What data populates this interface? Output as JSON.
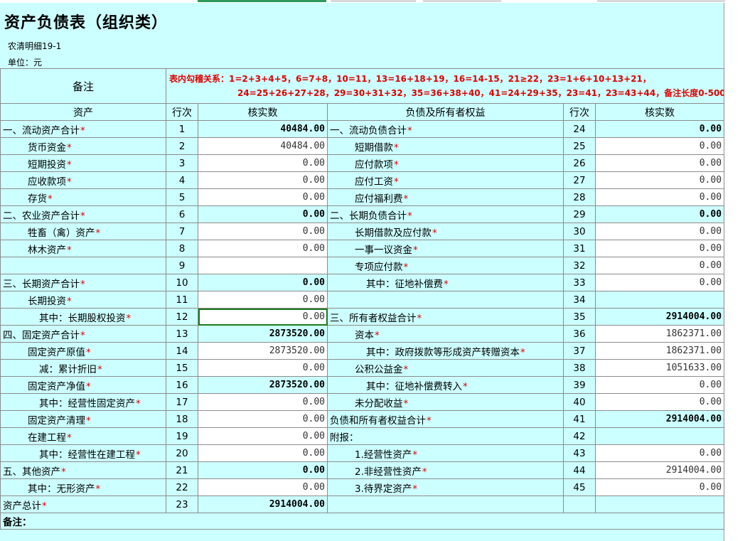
{
  "title": "资产负债表（组织类）",
  "form_code": "农清明细19-1",
  "unit_text": "单位：元",
  "note": {
    "label": "备注",
    "line1": "表内勾稽关系：1=2+3+4+5，6=7+8，10=11，13=16+18+19，16=14-15，21≥22，23=1+6+10+13+21，",
    "line2": "24=25+26+27+28，29=30+31+32，35=36+38+40，41=24+29+35，23=41，23=43+44，备注长度0-500。"
  },
  "columns": {
    "assets": "资产",
    "line_no": "行次",
    "verified": "核实数",
    "liabilities": "负债及所有者权益"
  },
  "star": "*",
  "rows": [
    {
      "left": {
        "label": "一、流动资产合计",
        "star": true,
        "indent": 0,
        "no": "1",
        "value": "40484.00",
        "bold": true
      },
      "right": {
        "label": "一、流动负债合计",
        "star": true,
        "indent": 0,
        "no": "24",
        "value": "0.00",
        "bold": true
      }
    },
    {
      "left": {
        "label": "货币资金",
        "star": true,
        "indent": 1,
        "no": "2",
        "value": "40484.00"
      },
      "right": {
        "label": "短期借款",
        "star": true,
        "indent": 1,
        "no": "25",
        "value": "0.00"
      }
    },
    {
      "left": {
        "label": "短期投资",
        "star": true,
        "indent": 1,
        "no": "3",
        "value": "0.00"
      },
      "right": {
        "label": "应付款项",
        "star": true,
        "indent": 1,
        "no": "26",
        "value": "0.00"
      }
    },
    {
      "left": {
        "label": "应收款项",
        "star": true,
        "indent": 1,
        "no": "4",
        "value": "0.00"
      },
      "right": {
        "label": "应付工资",
        "star": true,
        "indent": 1,
        "no": "27",
        "value": "0.00"
      }
    },
    {
      "left": {
        "label": "存货",
        "star": true,
        "indent": 1,
        "no": "5",
        "value": "0.00"
      },
      "right": {
        "label": "应付福利费",
        "star": true,
        "indent": 1,
        "no": "28",
        "value": "0.00"
      }
    },
    {
      "left": {
        "label": "二、农业资产合计",
        "star": true,
        "indent": 0,
        "no": "6",
        "value": "0.00",
        "bold": true
      },
      "right": {
        "label": "二、长期负债合计",
        "star": true,
        "indent": 0,
        "no": "29",
        "value": "0.00",
        "bold": true
      }
    },
    {
      "left": {
        "label": "牲畜（禽）资产",
        "star": true,
        "indent": 1,
        "no": "7",
        "value": "0.00"
      },
      "right": {
        "label": "长期借款及应付款",
        "star": true,
        "indent": 1,
        "no": "30",
        "value": "0.00"
      }
    },
    {
      "left": {
        "label": "林木资产",
        "star": true,
        "indent": 1,
        "no": "8",
        "value": "0.00"
      },
      "right": {
        "label": "一事一议资金",
        "star": true,
        "indent": 1,
        "no": "31",
        "value": "0.00"
      }
    },
    {
      "left": {
        "label": "",
        "star": false,
        "indent": 0,
        "no": "9",
        "value": ""
      },
      "right": {
        "label": "专项应付款",
        "star": true,
        "indent": 1,
        "no": "32",
        "value": "0.00"
      }
    },
    {
      "left": {
        "label": "三、长期资产合计",
        "star": true,
        "indent": 0,
        "no": "10",
        "value": "0.00",
        "bold": true
      },
      "right": {
        "label": "其中：征地补偿费",
        "star": true,
        "indent": 2,
        "no": "33",
        "value": "0.00"
      }
    },
    {
      "left": {
        "label": "长期投资",
        "star": true,
        "indent": 1,
        "no": "11",
        "value": "0.00"
      },
      "right": {
        "label": "",
        "star": false,
        "indent": 0,
        "no": "34",
        "value": "",
        "plain": true
      }
    },
    {
      "left": {
        "label": "其中：长期股权投资",
        "star": true,
        "indent": 2,
        "no": "12",
        "value": "0.00",
        "selected": true
      },
      "right": {
        "label": "三、所有者权益合计",
        "star": true,
        "indent": 0,
        "no": "35",
        "value": "2914004.00",
        "bold": true
      }
    },
    {
      "left": {
        "label": "四、固定资产合计",
        "star": true,
        "indent": 0,
        "no": "13",
        "value": "2873520.00",
        "bold": true
      },
      "right": {
        "label": "资本",
        "star": true,
        "indent": 1,
        "no": "36",
        "value": "1862371.00"
      }
    },
    {
      "left": {
        "label": "固定资产原值",
        "star": true,
        "indent": 1,
        "no": "14",
        "value": "2873520.00"
      },
      "right": {
        "label": "其中：政府拨款等形成资产转赠资本",
        "star": true,
        "indent": 2,
        "no": "37",
        "value": "1862371.00"
      }
    },
    {
      "left": {
        "label": "减：累计折旧",
        "star": true,
        "indent": 2,
        "no": "15",
        "value": "0.00"
      },
      "right": {
        "label": "公积公益金",
        "star": true,
        "indent": 1,
        "no": "38",
        "value": "1051633.00"
      }
    },
    {
      "left": {
        "label": "固定资产净值",
        "star": true,
        "indent": 1,
        "no": "16",
        "value": "2873520.00",
        "bold": true
      },
      "right": {
        "label": "其中：征地补偿费转入",
        "star": true,
        "indent": 2,
        "no": "39",
        "value": "0.00"
      }
    },
    {
      "left": {
        "label": "其中：经营性固定资产",
        "star": true,
        "indent": 2,
        "no": "17",
        "value": "0.00"
      },
      "right": {
        "label": "未分配收益",
        "star": true,
        "indent": 1,
        "no": "40",
        "value": "0.00"
      }
    },
    {
      "left": {
        "label": "固定资产清理",
        "star": true,
        "indent": 1,
        "no": "18",
        "value": "0.00"
      },
      "right": {
        "label": "负债和所有者权益合计",
        "star": true,
        "indent": 0,
        "no": "41",
        "value": "2914004.00",
        "bold": true
      }
    },
    {
      "left": {
        "label": "在建工程",
        "star": true,
        "indent": 1,
        "no": "19",
        "value": "0.00"
      },
      "right": {
        "label": "附报：",
        "star": false,
        "indent": 0,
        "no": "42",
        "value": "",
        "plain": true
      }
    },
    {
      "left": {
        "label": "其中：经营性在建工程",
        "star": true,
        "indent": 2,
        "no": "20",
        "value": "0.00"
      },
      "right": {
        "label": "1.经营性资产",
        "star": true,
        "indent": 1,
        "no": "43",
        "value": "0.00"
      }
    },
    {
      "left": {
        "label": "五、其他资产",
        "star": true,
        "indent": 0,
        "no": "21",
        "value": "0.00",
        "bold": true
      },
      "right": {
        "label": "2.非经营性资产",
        "star": true,
        "indent": 1,
        "no": "44",
        "value": "2914004.00"
      }
    },
    {
      "left": {
        "label": "其中：无形资产",
        "star": true,
        "indent": 1,
        "no": "22",
        "value": "0.00"
      },
      "right": {
        "label": "3.待界定资产",
        "star": true,
        "indent": 1,
        "no": "45",
        "value": "0.00"
      }
    },
    {
      "left": {
        "label": "资产总计",
        "star": true,
        "indent": 0,
        "no": "23",
        "value": "2914004.00",
        "bold": true
      },
      "right": {
        "label": "",
        "star": false,
        "indent": 0,
        "no": "",
        "value": "",
        "plain": true
      }
    }
  ],
  "remark_label": "备注："
}
